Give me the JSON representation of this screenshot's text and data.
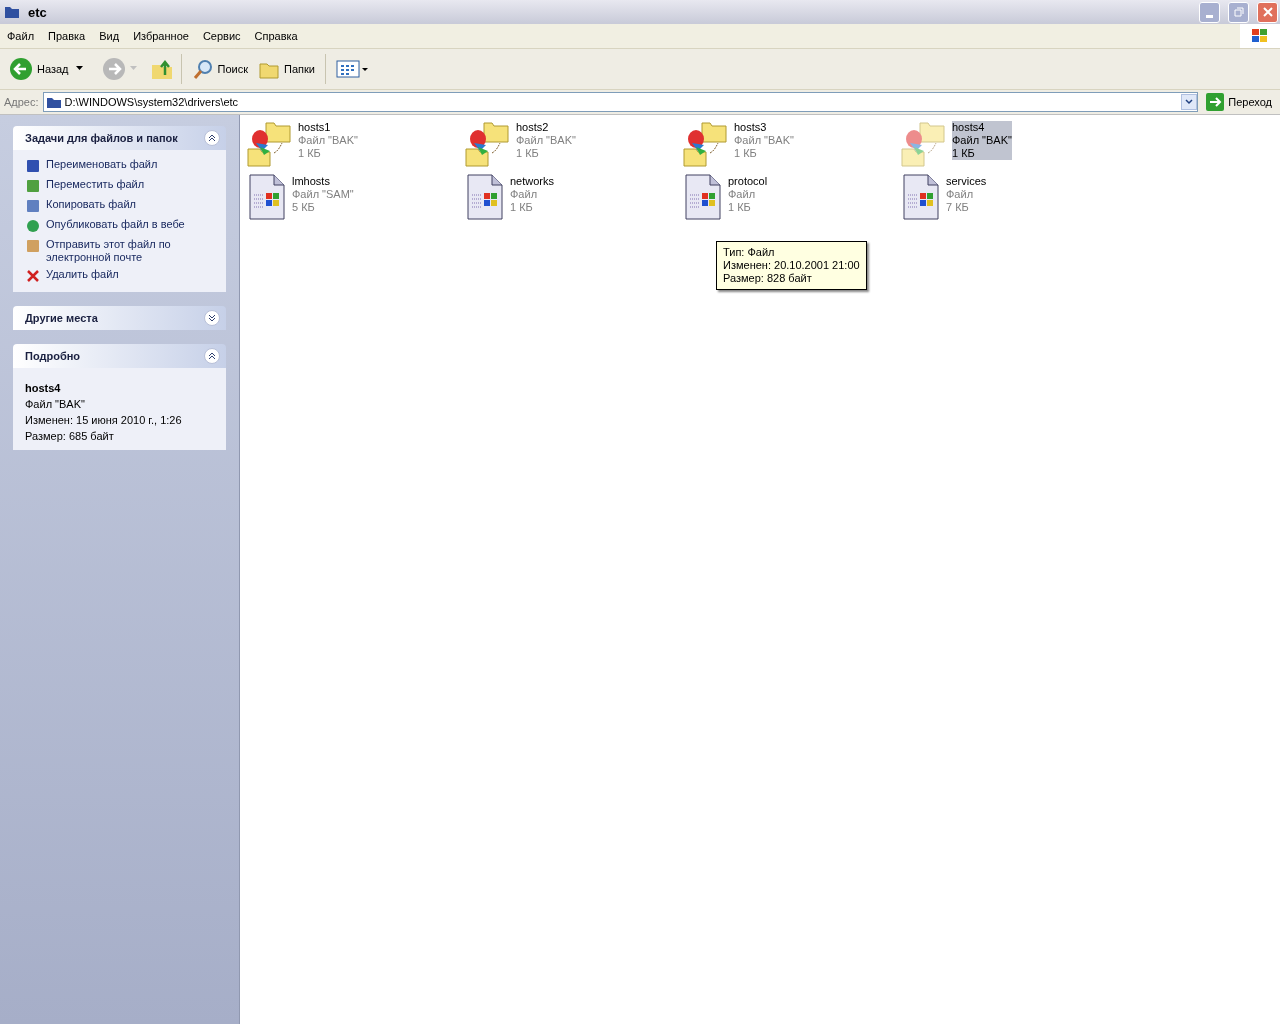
{
  "window": {
    "title": "etc"
  },
  "menu": [
    "Файл",
    "Правка",
    "Вид",
    "Избранное",
    "Сервис",
    "Справка"
  ],
  "toolbar": {
    "back": "Назад",
    "search": "Поиск",
    "folders": "Папки"
  },
  "address": {
    "label": "Адрес:",
    "value": "D:\\WINDOWS\\system32\\drivers\\etc",
    "go": "Переход"
  },
  "panels": [
    {
      "kind": "tasks",
      "title": "Задачи для файлов и папок",
      "expanded": true,
      "items": [
        {
          "kind": "rename",
          "label": "Переименовать файл"
        },
        {
          "kind": "move",
          "label": "Переместить файл"
        },
        {
          "kind": "copy",
          "label": "Копировать файл"
        },
        {
          "kind": "publish",
          "label": "Опубликовать файл в вебе"
        },
        {
          "kind": "email",
          "label": "Отправить этот файл по электронной почте"
        },
        {
          "kind": "delete",
          "label": "Удалить файл"
        }
      ]
    },
    {
      "kind": "places",
      "title": "Другие места",
      "expanded": false
    },
    {
      "kind": "details",
      "title": "Подробно",
      "expanded": true,
      "name": "hosts4",
      "type": "Файл \"BAK\"",
      "modified": "Изменен: 15 июня 2010 г., 1:26",
      "size": "Размер: 685 байт"
    }
  ],
  "files": [
    {
      "kind": "bak",
      "name": "hosts1",
      "type": "Файл \"BAK\"",
      "size": "1 КБ",
      "selected": false
    },
    {
      "kind": "bak",
      "name": "hosts2",
      "type": "Файл \"BAK\"",
      "size": "1 КБ",
      "selected": false
    },
    {
      "kind": "bak",
      "name": "hosts3",
      "type": "Файл \"BAK\"",
      "size": "1 КБ",
      "selected": false
    },
    {
      "kind": "bak",
      "name": "hosts4",
      "type": "Файл \"BAK\"",
      "size": "1 КБ",
      "selected": true
    },
    {
      "kind": "doc",
      "name": "lmhosts",
      "type": "Файл \"SAM\"",
      "size": "5 КБ",
      "selected": false
    },
    {
      "kind": "doc",
      "name": "networks",
      "type": "Файл",
      "size": "1 КБ",
      "selected": false
    },
    {
      "kind": "doc",
      "name": "protocol",
      "type": "Файл",
      "size": "1 КБ",
      "selected": false
    },
    {
      "kind": "doc",
      "name": "services",
      "type": "Файл",
      "size": "7 КБ",
      "selected": false
    }
  ],
  "tooltip": [
    "Тип: Файл",
    "Изменен: 20.10.2001 21:00",
    "Размер: 828 байт"
  ]
}
